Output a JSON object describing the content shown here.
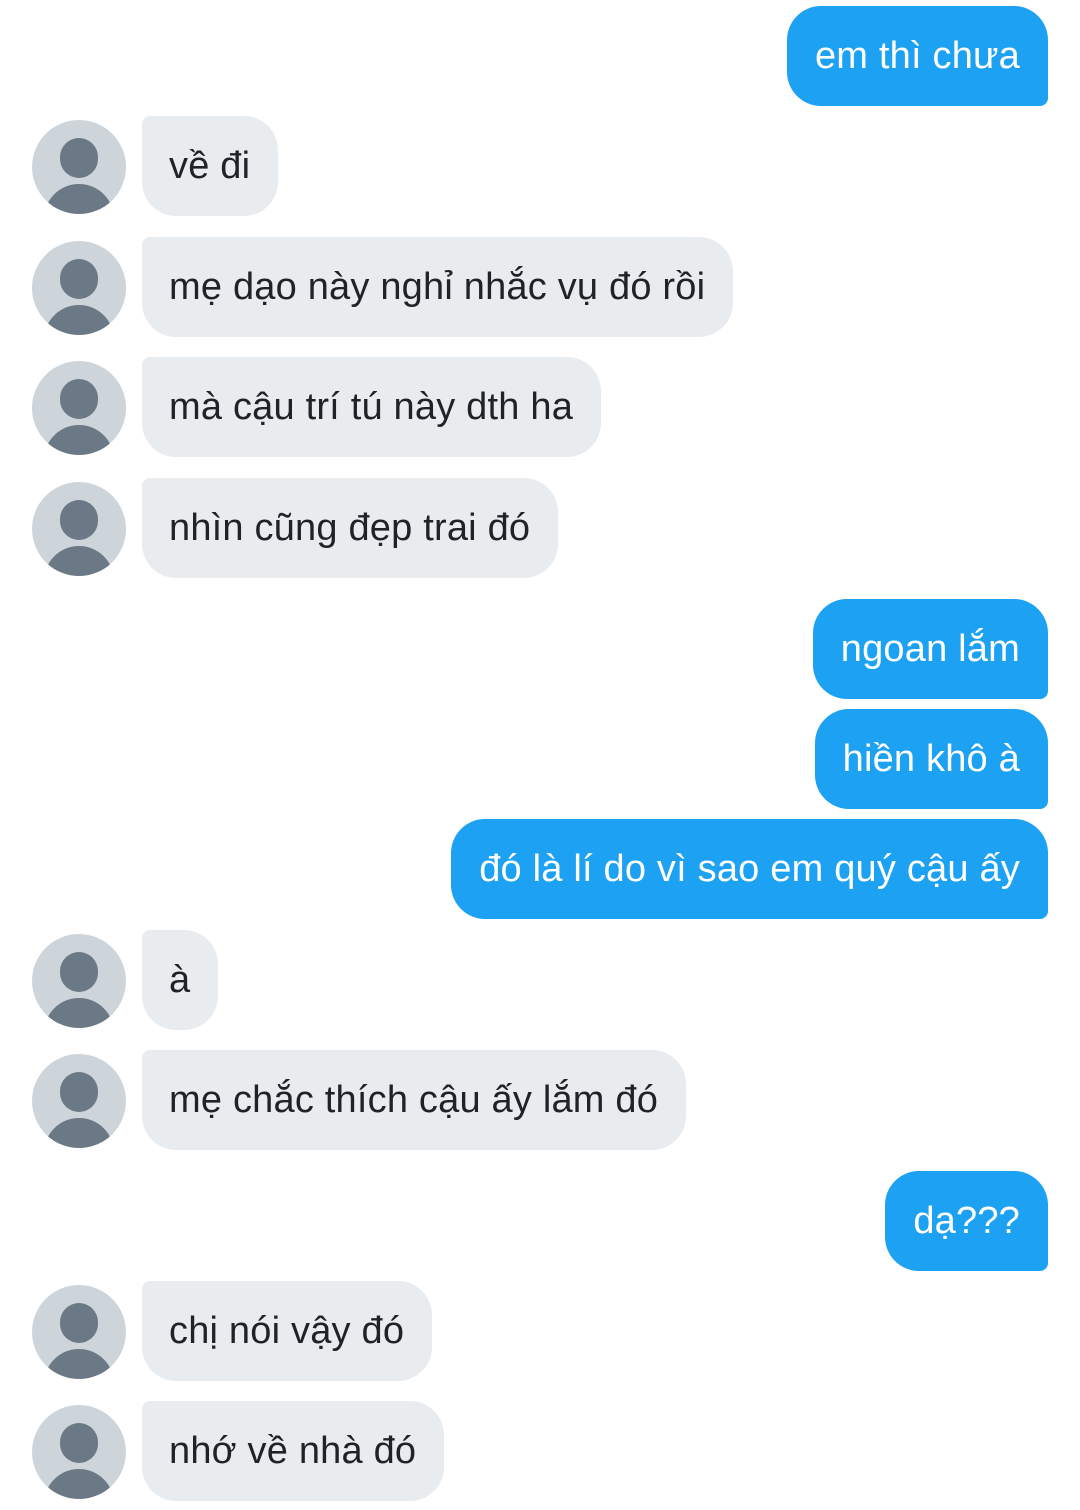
{
  "messages": [
    {
      "side": "out",
      "text": "em thì chưa"
    },
    {
      "side": "in",
      "text": "về đi"
    },
    {
      "side": "in",
      "text": "mẹ dạo này nghỉ nhắc vụ đó rồi"
    },
    {
      "side": "in",
      "text": "mà cậu trí tú này dth ha"
    },
    {
      "side": "in",
      "text": "nhìn cũng đẹp trai đó"
    },
    {
      "side": "out",
      "text": "ngoan lắm"
    },
    {
      "side": "out",
      "text": "hiền khô à"
    },
    {
      "side": "out",
      "text": "đó là lí do vì sao em quý cậu ấy"
    },
    {
      "side": "in",
      "text": "à"
    },
    {
      "side": "in",
      "text": "mẹ chắc thích cậu ấy lắm đó"
    },
    {
      "side": "out",
      "text": "dạ???"
    },
    {
      "side": "in",
      "text": "chị nói vậy đó"
    },
    {
      "side": "in",
      "text": "nhớ về nhà đó"
    }
  ],
  "avatar": {
    "icon": "user-placeholder-icon"
  },
  "colors": {
    "outgoing_bubble": "#1da1f2",
    "incoming_bubble": "#e9ecef",
    "incoming_text": "#1f2327",
    "avatar_bg": "#cdd5db",
    "avatar_fg": "#6b7885"
  }
}
